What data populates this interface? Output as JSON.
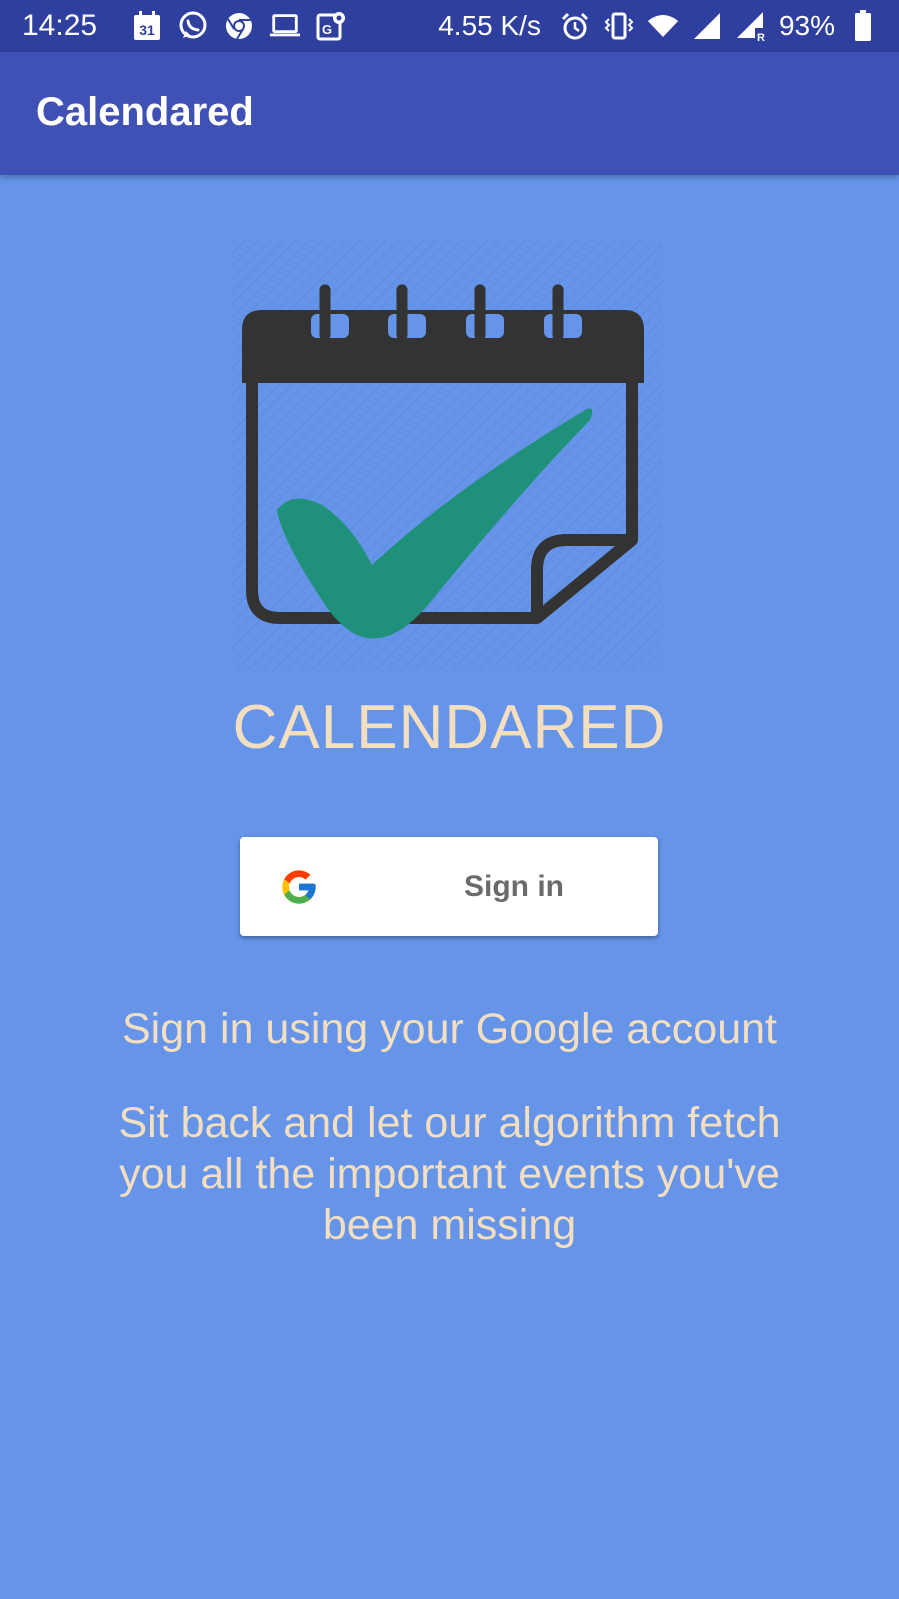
{
  "status_bar": {
    "time": "14:25",
    "calendar_date": "31",
    "net_speed": "4.55 K/s",
    "battery": "93%",
    "icons": [
      "calendar-icon",
      "whatsapp-icon",
      "chrome-icon",
      "laptop-icon",
      "maps-icon",
      "alarm-icon",
      "vibrate-icon",
      "wifi-icon",
      "signal-icon",
      "signal-roaming-icon",
      "battery-icon"
    ]
  },
  "app_bar": {
    "title": "Calendared"
  },
  "logo": {
    "wordmark": "CALENDARED",
    "icon": "calendar-check-icon",
    "check_color": "#1f9079",
    "frame_color": "#333333"
  },
  "signin": {
    "label": "Sign in",
    "icon": "google-g-icon"
  },
  "tagline": "Sign in using your Google account",
  "description": "Sit back and let our algorithm fetch you all the important events you've been missing",
  "colors": {
    "background": "#6594e9",
    "app_bar": "#3f51b5",
    "status_bar": "#2f3f9e",
    "accent_text": "#f3dfc0"
  }
}
